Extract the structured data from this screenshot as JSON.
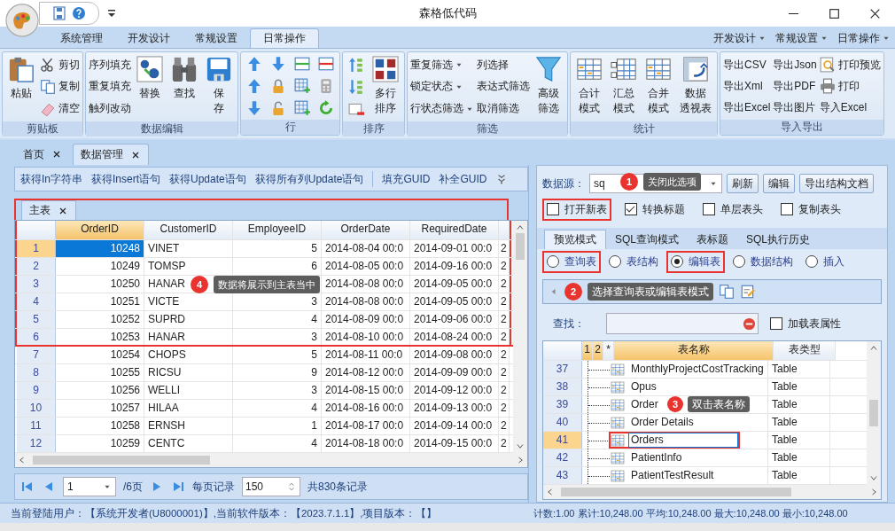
{
  "window": {
    "title": "森格低代码"
  },
  "ribbon": {
    "tabs": [
      {
        "label": "系统管理",
        "selected": false
      },
      {
        "label": "开发设计",
        "selected": false
      },
      {
        "label": "常规设置",
        "selected": false
      },
      {
        "label": "日常操作",
        "selected": true
      }
    ],
    "menus": [
      "开发设计",
      "常规设置",
      "日常操作"
    ],
    "groups": [
      {
        "label": "剪贴板",
        "columns": [
          [
            {
              "kind": "large",
              "lines": [
                "粘贴"
              ]
            }
          ],
          [
            {
              "kind": "small",
              "label": "剪切"
            },
            {
              "kind": "small",
              "label": "复制"
            },
            {
              "kind": "small",
              "label": "清空"
            }
          ]
        ]
      },
      {
        "label": "数据编辑",
        "columns": [
          [
            {
              "kind": "text",
              "label": "序列填充"
            },
            {
              "kind": "text",
              "label": "重复填充"
            },
            {
              "kind": "text",
              "label": "触列改动"
            }
          ],
          [
            {
              "kind": "large",
              "lines": [
                "替换"
              ]
            }
          ],
          [
            {
              "kind": "large",
              "lines": [
                "查找"
              ]
            }
          ],
          [
            {
              "kind": "large",
              "lines": [
                "保",
                "存"
              ]
            }
          ]
        ]
      },
      {
        "label": "行",
        "columns": [
          [
            {
              "kind": "icon"
            },
            {
              "kind": "icon"
            },
            {
              "kind": "icon"
            }
          ],
          [
            {
              "kind": "icon"
            },
            {
              "kind": "icon"
            },
            {
              "kind": "icon"
            }
          ],
          [
            {
              "kind": "icon"
            },
            {
              "kind": "icon"
            },
            {
              "kind": "icon"
            }
          ],
          [
            {
              "kind": "icon"
            },
            {
              "kind": "icon"
            },
            {
              "kind": "icon"
            }
          ]
        ]
      },
      {
        "label": "排序",
        "columns": [
          [
            {
              "kind": "icon"
            },
            {
              "kind": "icon"
            },
            {
              "kind": "icon"
            }
          ],
          [
            {
              "kind": "large",
              "lines": [
                "多行",
                "排序"
              ]
            }
          ]
        ]
      },
      {
        "label": "筛选",
        "columns": [
          [
            {
              "kind": "dropdown",
              "label": "重复筛选"
            },
            {
              "kind": "dropdown",
              "label": "锁定状态"
            },
            {
              "kind": "dropdown",
              "label": "行状态筛选"
            }
          ],
          [
            {
              "kind": "text",
              "label": "列选择"
            },
            {
              "kind": "text",
              "label": "表达式筛选"
            },
            {
              "kind": "text",
              "label": "取消筛选"
            }
          ],
          [
            {
              "kind": "large",
              "lines": [
                "高级",
                "筛选"
              ]
            }
          ]
        ]
      },
      {
        "label": "统计",
        "columns": [
          [
            {
              "kind": "large",
              "lines": [
                "合计",
                "模式"
              ]
            }
          ],
          [
            {
              "kind": "large",
              "lines": [
                "汇总",
                "模式"
              ]
            }
          ],
          [
            {
              "kind": "large",
              "lines": [
                "合并",
                "模式"
              ]
            }
          ],
          [
            {
              "kind": "large",
              "lines": [
                "数据",
                "透视表"
              ]
            }
          ]
        ]
      },
      {
        "label": "导入导出",
        "columns": [
          [
            {
              "kind": "text",
              "label": "导出CSV"
            },
            {
              "kind": "text",
              "label": "导出Xml"
            },
            {
              "kind": "text",
              "label": "导出Excel"
            }
          ],
          [
            {
              "kind": "text",
              "label": "导出Json"
            },
            {
              "kind": "text",
              "label": "导出PDF"
            },
            {
              "kind": "text",
              "label": "导出图片"
            }
          ],
          [
            {
              "kind": "small",
              "label": "打印预览"
            },
            {
              "kind": "small",
              "label": "打印"
            },
            {
              "kind": "text",
              "label": "导入Excel"
            }
          ]
        ]
      }
    ]
  },
  "doc_tabs": [
    {
      "label": "首页",
      "selected": false
    },
    {
      "label": "数据管理",
      "selected": true
    }
  ],
  "left": {
    "toolbar": [
      "获得In字符串",
      "获得Insert语句",
      "获得Update语句",
      "获得所有列Update语句",
      "填充GUID",
      "补全GUID"
    ],
    "sub_tab": "主表",
    "callout": {
      "number": "4",
      "text": "数据将展示到主表当中"
    },
    "columns": [
      {
        "label": "OrderID",
        "selected": true
      },
      {
        "label": "CustomerID",
        "selected": false
      },
      {
        "label": "EmployeeID",
        "selected": false
      },
      {
        "label": "OrderDate",
        "selected": false
      },
      {
        "label": "RequiredDate",
        "selected": false
      }
    ],
    "rows": [
      {
        "num": "1",
        "cells": [
          "10248",
          "VINET",
          "5",
          "2014-08-04 00:0",
          "2014-09-01 00:0",
          "2"
        ],
        "selected": true,
        "highlighted": true
      },
      {
        "num": "2",
        "cells": [
          "10249",
          "TOMSP",
          "6",
          "2014-08-05 00:0",
          "2014-09-16 00:0",
          "2"
        ],
        "selected": false,
        "highlighted": true
      },
      {
        "num": "3",
        "cells": [
          "10250",
          "HANAR",
          null,
          "2014-08-08 00:0",
          "2014-09-05 00:0",
          "2"
        ],
        "selected": false,
        "highlighted": true
      },
      {
        "num": "4",
        "cells": [
          "10251",
          "VICTE",
          "3",
          "2014-08-08 00:0",
          "2014-09-05 00:0",
          "2"
        ],
        "selected": false,
        "highlighted": true
      },
      {
        "num": "5",
        "cells": [
          "10252",
          "SUPRD",
          "4",
          "2014-08-09 00:0",
          "2014-09-06 00:0",
          "2"
        ],
        "selected": false,
        "highlighted": true
      },
      {
        "num": "6",
        "cells": [
          "10253",
          "HANAR",
          "3",
          "2014-08-10 00:0",
          "2014-08-24 00:0",
          "2"
        ],
        "selected": false,
        "highlighted": true
      },
      {
        "num": "7",
        "cells": [
          "10254",
          "CHOPS",
          "5",
          "2014-08-11 00:0",
          "2014-09-08 00:0",
          "2"
        ],
        "selected": false,
        "highlighted": false
      },
      {
        "num": "8",
        "cells": [
          "10255",
          "RICSU",
          "9",
          "2014-08-12 00:0",
          "2014-09-09 00:0",
          "2"
        ],
        "selected": false,
        "highlighted": false
      },
      {
        "num": "9",
        "cells": [
          "10256",
          "WELLI",
          "3",
          "2014-08-15 00:0",
          "2014-09-12 00:0",
          "2"
        ],
        "selected": false,
        "highlighted": false
      },
      {
        "num": "10",
        "cells": [
          "10257",
          "HILAA",
          "4",
          "2014-08-16 00:0",
          "2014-09-13 00:0",
          "2"
        ],
        "selected": false,
        "highlighted": false
      },
      {
        "num": "11",
        "cells": [
          "10258",
          "ERNSH",
          "1",
          "2014-08-17 00:0",
          "2014-09-14 00:0",
          "2"
        ],
        "selected": false,
        "highlighted": false
      },
      {
        "num": "12",
        "cells": [
          "10259",
          "CENTC",
          "4",
          "2014-08-18 00:0",
          "2014-09-15 00:0",
          "2"
        ],
        "selected": false,
        "highlighted": false
      }
    ],
    "pager": {
      "page": "1",
      "pages": "/6页",
      "per_page_label": "每页记录",
      "per_page": "150",
      "total": "共830条记录"
    }
  },
  "right": {
    "datasource": {
      "label": "数据源：",
      "value": "sq",
      "callout": {
        "number": "1",
        "text": "关闭此选项"
      }
    },
    "buttons": [
      "刷新",
      "编辑",
      "导出结构文档"
    ],
    "checkboxes": [
      {
        "label": "打开新表",
        "checked": false,
        "highlighted": true
      },
      {
        "label": "转换标题",
        "checked": true,
        "highlighted": false
      },
      {
        "label": "单层表头",
        "checked": false,
        "highlighted": false
      },
      {
        "label": "复制表头",
        "checked": false,
        "highlighted": false
      }
    ],
    "tabs": [
      {
        "label": "预览模式",
        "selected": true
      },
      {
        "label": "SQL查询模式",
        "selected": false
      },
      {
        "label": "表标题",
        "selected": false
      },
      {
        "label": "SQL执行历史",
        "selected": false
      }
    ],
    "modes": [
      {
        "label": "查询表",
        "selected": false,
        "highlighted": true
      },
      {
        "label": "表结构",
        "selected": false,
        "highlighted": false
      },
      {
        "label": "编辑表",
        "selected": true,
        "highlighted": true
      },
      {
        "label": "数据结构",
        "selected": false,
        "highlighted": false
      },
      {
        "label": "插入",
        "selected": false,
        "highlighted": false
      }
    ],
    "toolbar_callout": {
      "number": "2",
      "text": "选择查询表或编辑表模式"
    },
    "find": {
      "label": "查找：",
      "option": {
        "label": "加载表属性",
        "checked": false
      }
    },
    "columns": [
      {
        "label": "1",
        "selected": true
      },
      {
        "label": "2",
        "selected": true
      },
      {
        "label": "*",
        "selected": false
      },
      {
        "label": "表名称",
        "selected": true
      },
      {
        "label": "表类型",
        "selected": false
      }
    ],
    "rows": [
      {
        "num": "37",
        "name": "MonthlyProjectCostTracking",
        "type": "Table",
        "selected": false,
        "highlighted": false
      },
      {
        "num": "38",
        "name": "Opus",
        "type": "Table",
        "selected": false,
        "highlighted": false
      },
      {
        "num": "39",
        "name": "Order",
        "type": "Table",
        "selected": false,
        "highlighted": false,
        "callout": {
          "number": "3",
          "text": "双击表名称"
        }
      },
      {
        "num": "40",
        "name": "Order Details",
        "type": "Table",
        "selected": false,
        "highlighted": false
      },
      {
        "num": "41",
        "name": "Orders",
        "type": "Table",
        "selected": true,
        "highlighted": true
      },
      {
        "num": "42",
        "name": "PatientInfo",
        "type": "Table",
        "selected": false,
        "highlighted": false
      },
      {
        "num": "43",
        "name": "PatientTestResult",
        "type": "Table",
        "selected": false,
        "highlighted": false
      }
    ]
  },
  "status_bar": {
    "left": "当前登陆用户：【系统开发者(U8000001)】,当前软件版本：【2023.7.1.1】,项目版本：【】",
    "right": "计数:1.00 累计:10,248.00 平均:10,248.00 最大:10,248.00 最小:10,248.00"
  }
}
